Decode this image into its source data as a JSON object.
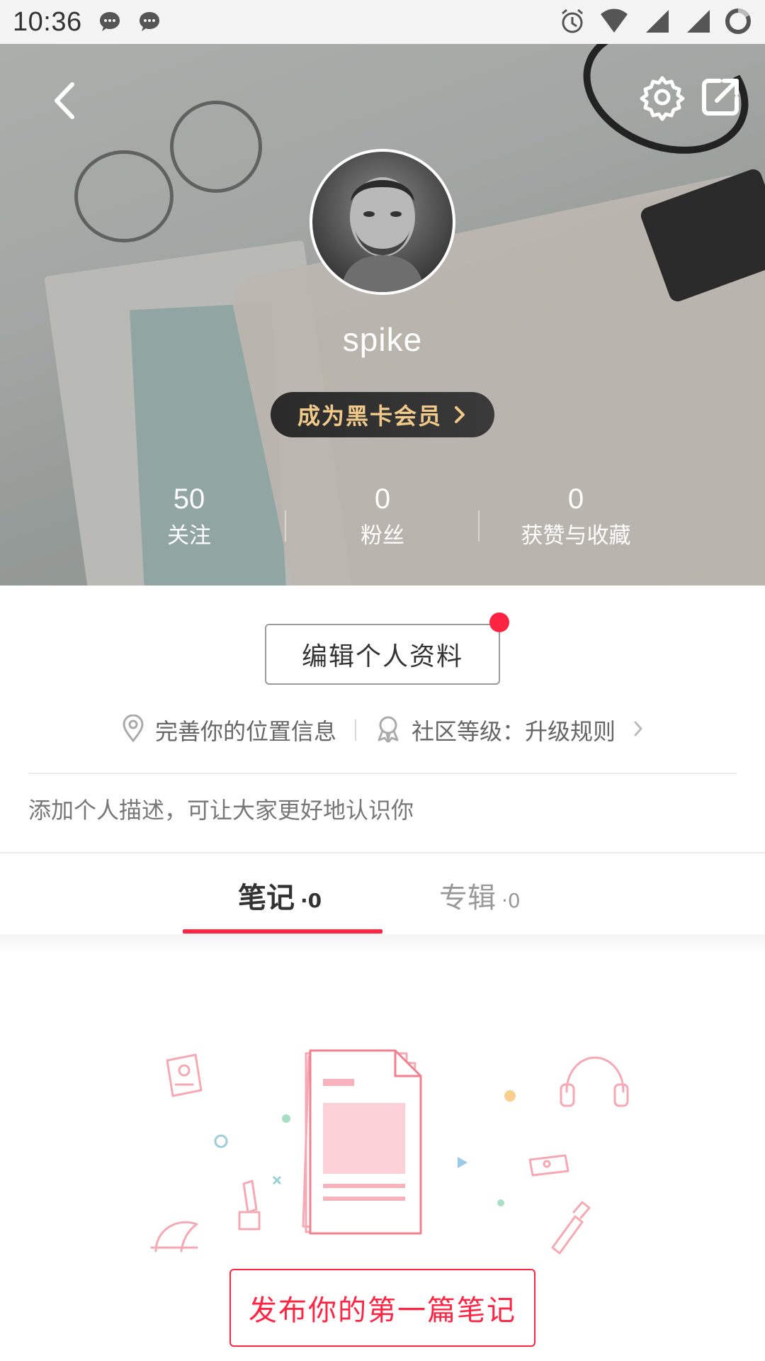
{
  "status_bar": {
    "time": "10:36",
    "icons": [
      "message-bubble-icon",
      "message-bubble-icon",
      "alarm-icon",
      "wifi-icon",
      "signal-icon",
      "signal-icon",
      "battery-ring-icon"
    ]
  },
  "header": {
    "back_icon": "chevron-left-icon",
    "settings_icon": "gear-icon",
    "share_icon": "share-icon"
  },
  "profile": {
    "username": "spike",
    "vip_button_label": "成为黑卡会员",
    "stats": [
      {
        "value": "50",
        "label": "关注"
      },
      {
        "value": "0",
        "label": "粉丝"
      },
      {
        "value": "0",
        "label": "获赞与收藏"
      }
    ],
    "edit_button_label": "编辑个人资料",
    "location_text": "完善你的位置信息",
    "level_text": "社区等级：升级规则",
    "bio_placeholder": "添加个人描述，可让大家更好地认识你"
  },
  "tabs": [
    {
      "label": "笔记",
      "count": "·0",
      "active": true
    },
    {
      "label": "专辑",
      "count": "·0",
      "active": false
    }
  ],
  "empty_state": {
    "publish_button_label": "发布你的第一篇笔记"
  },
  "colors": {
    "accent": "#ff2442",
    "vip_gold": "#f0c98b",
    "illustration_pink": "#f2808f"
  }
}
